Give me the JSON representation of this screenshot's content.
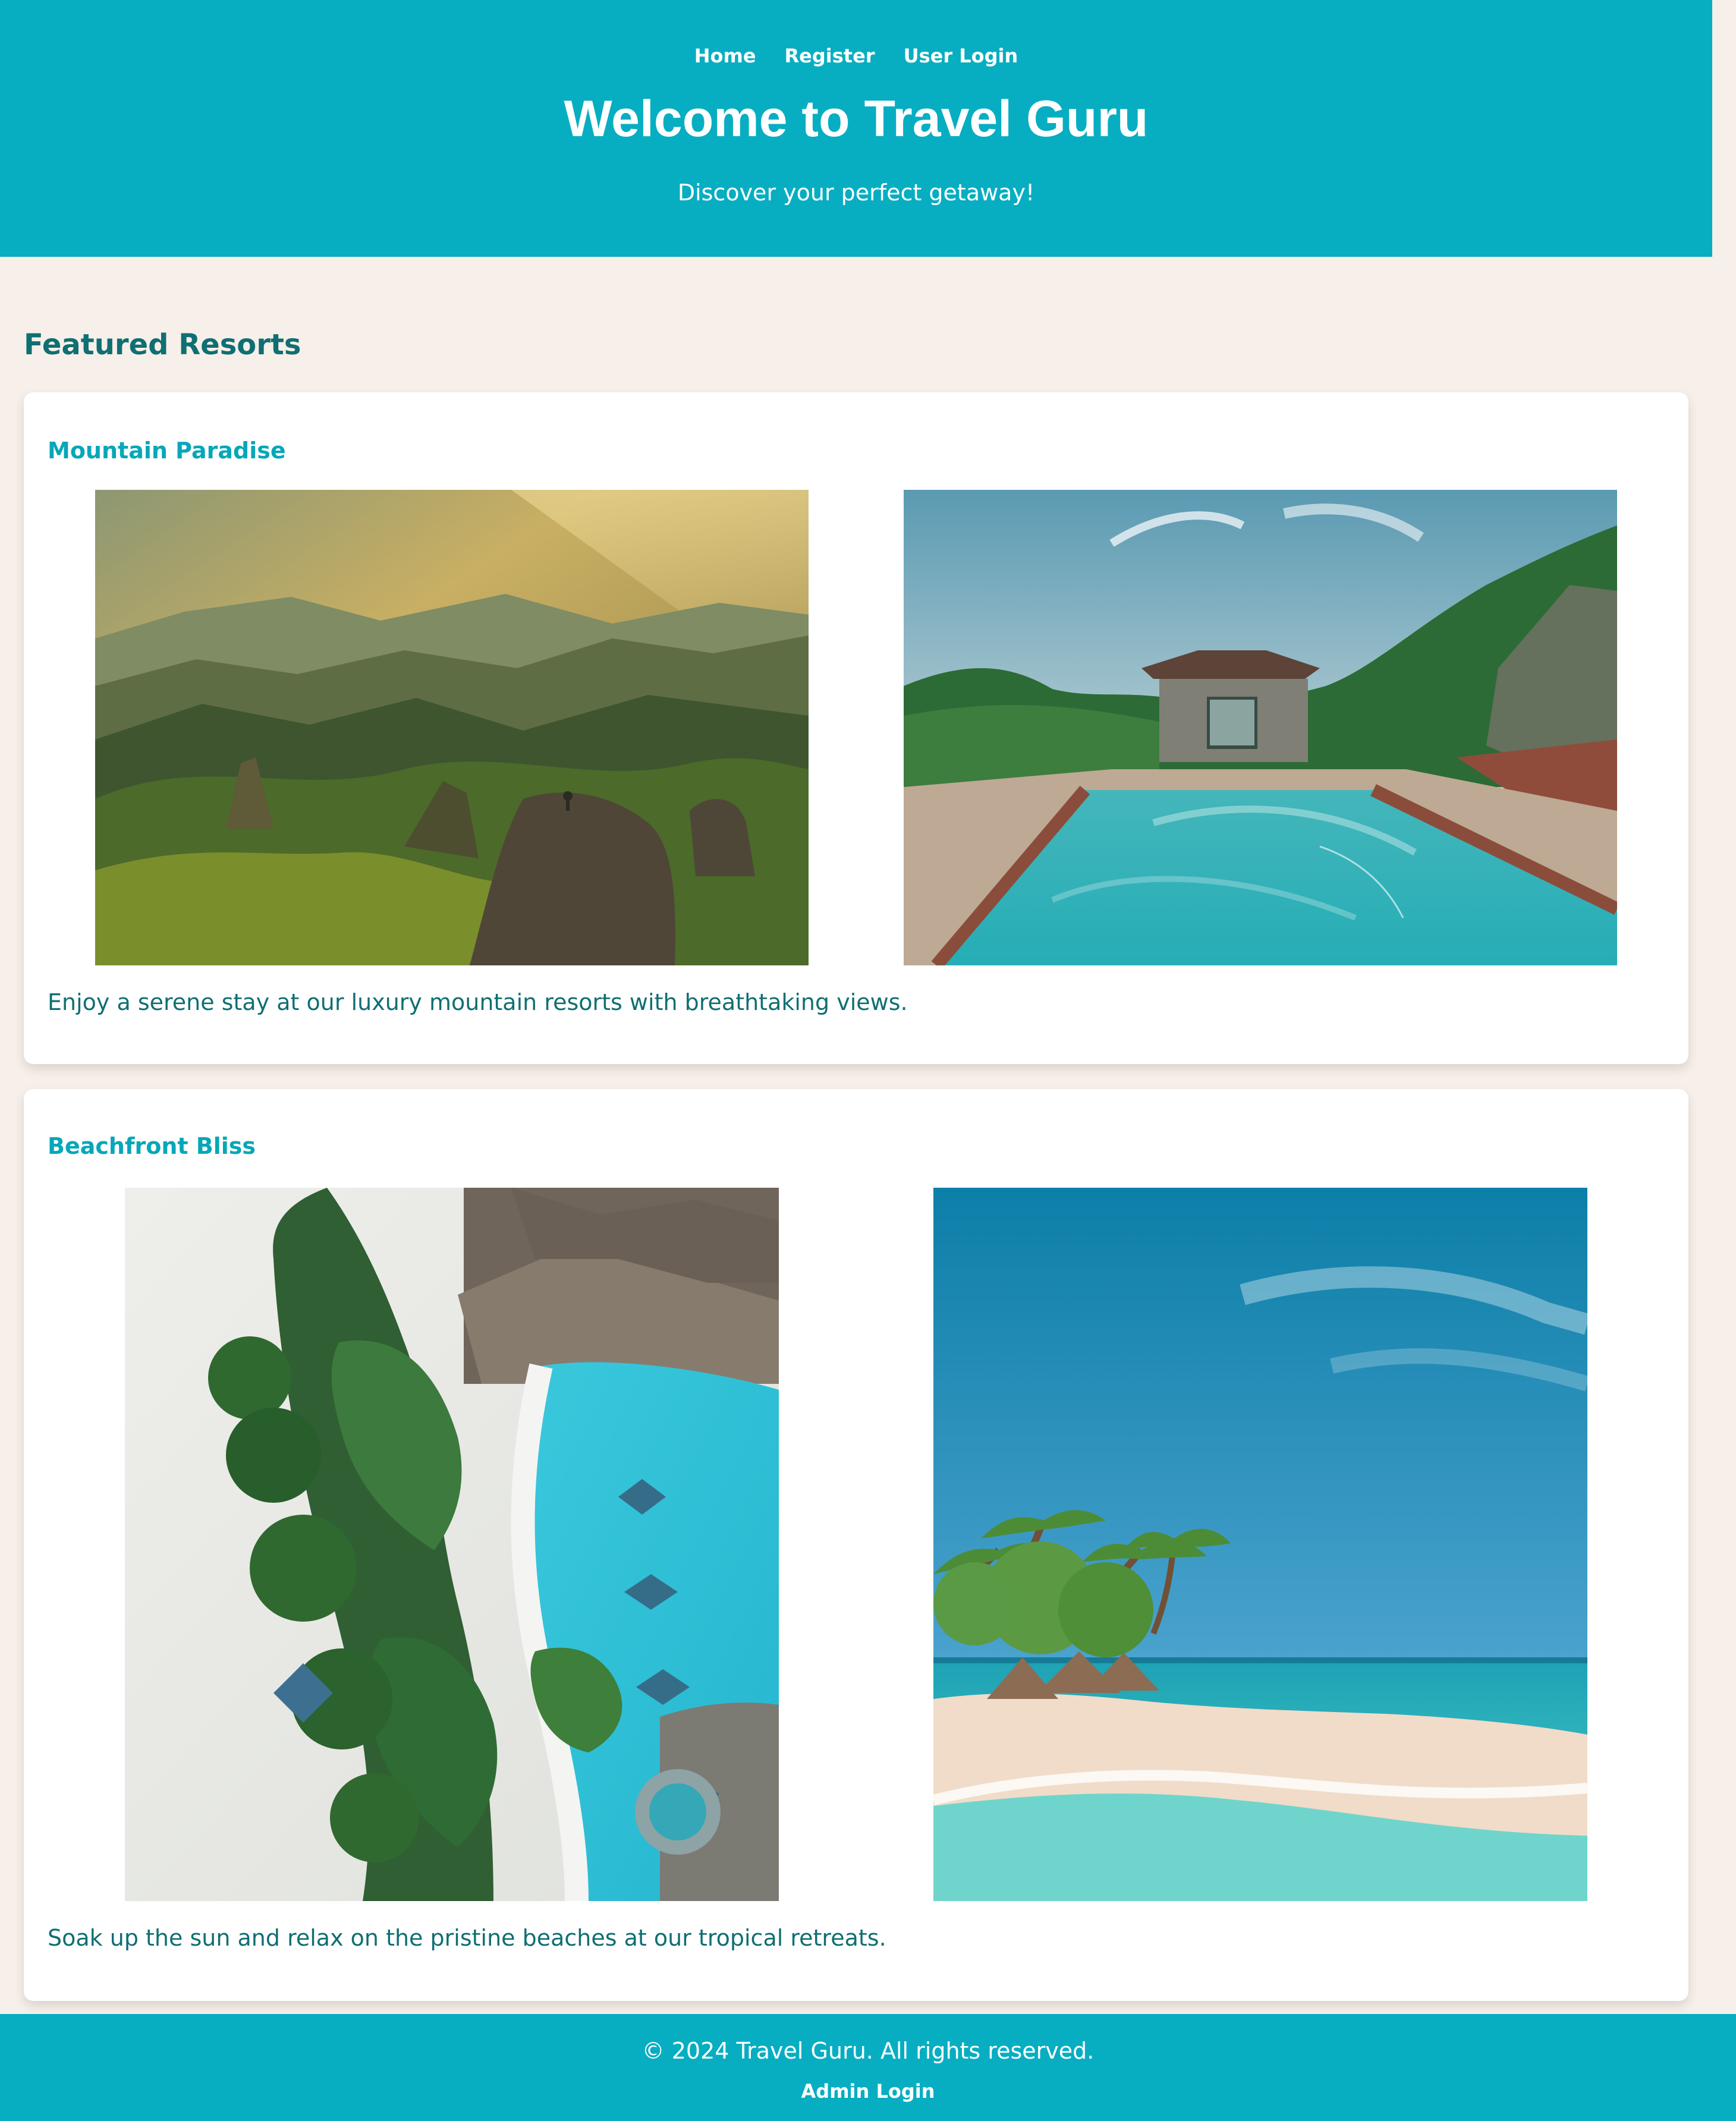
{
  "site": {
    "nav": [
      {
        "label": "Home"
      },
      {
        "label": "Register"
      },
      {
        "label": "User Login"
      }
    ],
    "hero": {
      "title": "Welcome to Travel Guru",
      "subtitle": "Discover your perfect getaway!"
    },
    "section_title": "Featured Resorts"
  },
  "resorts": [
    {
      "title": "Mountain Paradise",
      "description": "Enjoy a serene stay at our luxury mountain resorts with breathtaking views.",
      "images": [
        {
          "icon": "mountain-landscape-photo"
        },
        {
          "icon": "resort-pool-photo"
        }
      ]
    },
    {
      "title": "Beachfront Bliss",
      "description": "Soak up the sun and relax on the pristine beaches at our tropical retreats.",
      "images": [
        {
          "icon": "aerial-beach-resort-photo"
        },
        {
          "icon": "tropical-beach-photo"
        }
      ]
    }
  ],
  "footer": {
    "copyright": "© 2024 Travel Guru. All rights reserved.",
    "admin_login": "Admin Login"
  },
  "colors": {
    "header_bg": "#07aec2",
    "page_bg": "#f7efe9",
    "accent_text": "#0f6f72",
    "title_accent": "#06a7b8"
  }
}
